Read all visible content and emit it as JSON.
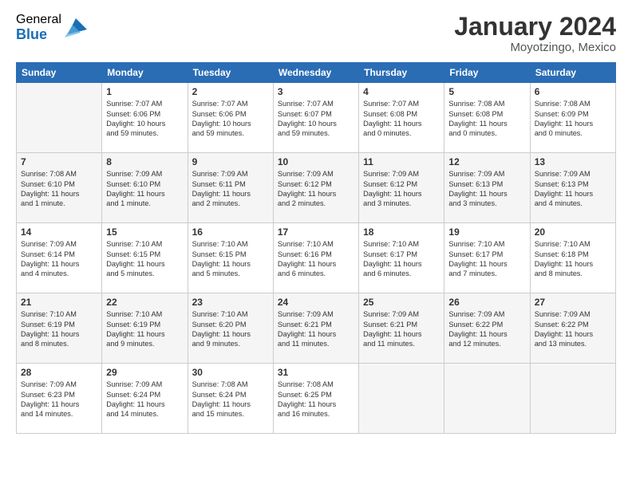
{
  "logo": {
    "general": "General",
    "blue": "Blue"
  },
  "title": "January 2024",
  "location": "Moyotzingo, Mexico",
  "days_header": [
    "Sunday",
    "Monday",
    "Tuesday",
    "Wednesday",
    "Thursday",
    "Friday",
    "Saturday"
  ],
  "weeks": [
    [
      {
        "num": "",
        "info": ""
      },
      {
        "num": "1",
        "info": "Sunrise: 7:07 AM\nSunset: 6:06 PM\nDaylight: 10 hours\nand 59 minutes."
      },
      {
        "num": "2",
        "info": "Sunrise: 7:07 AM\nSunset: 6:06 PM\nDaylight: 10 hours\nand 59 minutes."
      },
      {
        "num": "3",
        "info": "Sunrise: 7:07 AM\nSunset: 6:07 PM\nDaylight: 10 hours\nand 59 minutes."
      },
      {
        "num": "4",
        "info": "Sunrise: 7:07 AM\nSunset: 6:08 PM\nDaylight: 11 hours\nand 0 minutes."
      },
      {
        "num": "5",
        "info": "Sunrise: 7:08 AM\nSunset: 6:08 PM\nDaylight: 11 hours\nand 0 minutes."
      },
      {
        "num": "6",
        "info": "Sunrise: 7:08 AM\nSunset: 6:09 PM\nDaylight: 11 hours\nand 0 minutes."
      }
    ],
    [
      {
        "num": "7",
        "info": "Sunrise: 7:08 AM\nSunset: 6:10 PM\nDaylight: 11 hours\nand 1 minute."
      },
      {
        "num": "8",
        "info": "Sunrise: 7:09 AM\nSunset: 6:10 PM\nDaylight: 11 hours\nand 1 minute."
      },
      {
        "num": "9",
        "info": "Sunrise: 7:09 AM\nSunset: 6:11 PM\nDaylight: 11 hours\nand 2 minutes."
      },
      {
        "num": "10",
        "info": "Sunrise: 7:09 AM\nSunset: 6:12 PM\nDaylight: 11 hours\nand 2 minutes."
      },
      {
        "num": "11",
        "info": "Sunrise: 7:09 AM\nSunset: 6:12 PM\nDaylight: 11 hours\nand 3 minutes."
      },
      {
        "num": "12",
        "info": "Sunrise: 7:09 AM\nSunset: 6:13 PM\nDaylight: 11 hours\nand 3 minutes."
      },
      {
        "num": "13",
        "info": "Sunrise: 7:09 AM\nSunset: 6:13 PM\nDaylight: 11 hours\nand 4 minutes."
      }
    ],
    [
      {
        "num": "14",
        "info": "Sunrise: 7:09 AM\nSunset: 6:14 PM\nDaylight: 11 hours\nand 4 minutes."
      },
      {
        "num": "15",
        "info": "Sunrise: 7:10 AM\nSunset: 6:15 PM\nDaylight: 11 hours\nand 5 minutes."
      },
      {
        "num": "16",
        "info": "Sunrise: 7:10 AM\nSunset: 6:15 PM\nDaylight: 11 hours\nand 5 minutes."
      },
      {
        "num": "17",
        "info": "Sunrise: 7:10 AM\nSunset: 6:16 PM\nDaylight: 11 hours\nand 6 minutes."
      },
      {
        "num": "18",
        "info": "Sunrise: 7:10 AM\nSunset: 6:17 PM\nDaylight: 11 hours\nand 6 minutes."
      },
      {
        "num": "19",
        "info": "Sunrise: 7:10 AM\nSunset: 6:17 PM\nDaylight: 11 hours\nand 7 minutes."
      },
      {
        "num": "20",
        "info": "Sunrise: 7:10 AM\nSunset: 6:18 PM\nDaylight: 11 hours\nand 8 minutes."
      }
    ],
    [
      {
        "num": "21",
        "info": "Sunrise: 7:10 AM\nSunset: 6:19 PM\nDaylight: 11 hours\nand 8 minutes."
      },
      {
        "num": "22",
        "info": "Sunrise: 7:10 AM\nSunset: 6:19 PM\nDaylight: 11 hours\nand 9 minutes."
      },
      {
        "num": "23",
        "info": "Sunrise: 7:10 AM\nSunset: 6:20 PM\nDaylight: 11 hours\nand 9 minutes."
      },
      {
        "num": "24",
        "info": "Sunrise: 7:09 AM\nSunset: 6:21 PM\nDaylight: 11 hours\nand 11 minutes."
      },
      {
        "num": "25",
        "info": "Sunrise: 7:09 AM\nSunset: 6:21 PM\nDaylight: 11 hours\nand 11 minutes."
      },
      {
        "num": "26",
        "info": "Sunrise: 7:09 AM\nSunset: 6:22 PM\nDaylight: 11 hours\nand 12 minutes."
      },
      {
        "num": "27",
        "info": "Sunrise: 7:09 AM\nSunset: 6:22 PM\nDaylight: 11 hours\nand 13 minutes."
      }
    ],
    [
      {
        "num": "28",
        "info": "Sunrise: 7:09 AM\nSunset: 6:23 PM\nDaylight: 11 hours\nand 14 minutes."
      },
      {
        "num": "29",
        "info": "Sunrise: 7:09 AM\nSunset: 6:24 PM\nDaylight: 11 hours\nand 14 minutes."
      },
      {
        "num": "30",
        "info": "Sunrise: 7:08 AM\nSunset: 6:24 PM\nDaylight: 11 hours\nand 15 minutes."
      },
      {
        "num": "31",
        "info": "Sunrise: 7:08 AM\nSunset: 6:25 PM\nDaylight: 11 hours\nand 16 minutes."
      },
      {
        "num": "",
        "info": ""
      },
      {
        "num": "",
        "info": ""
      },
      {
        "num": "",
        "info": ""
      }
    ]
  ]
}
